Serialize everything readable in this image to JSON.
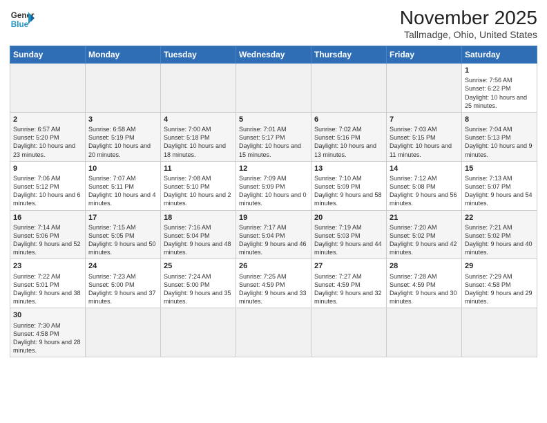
{
  "header": {
    "logo_line1": "General",
    "logo_line2": "Blue",
    "title": "November 2025",
    "subtitle": "Tallmadge, Ohio, United States"
  },
  "days_of_week": [
    "Sunday",
    "Monday",
    "Tuesday",
    "Wednesday",
    "Thursday",
    "Friday",
    "Saturday"
  ],
  "weeks": [
    [
      {
        "num": "",
        "info": ""
      },
      {
        "num": "",
        "info": ""
      },
      {
        "num": "",
        "info": ""
      },
      {
        "num": "",
        "info": ""
      },
      {
        "num": "",
        "info": ""
      },
      {
        "num": "",
        "info": ""
      },
      {
        "num": "1",
        "info": "Sunrise: 7:56 AM\nSunset: 6:22 PM\nDaylight: 10 hours\nand 25 minutes."
      }
    ],
    [
      {
        "num": "2",
        "info": "Sunrise: 6:57 AM\nSunset: 5:20 PM\nDaylight: 10 hours\nand 23 minutes."
      },
      {
        "num": "3",
        "info": "Sunrise: 6:58 AM\nSunset: 5:19 PM\nDaylight: 10 hours\nand 20 minutes."
      },
      {
        "num": "4",
        "info": "Sunrise: 7:00 AM\nSunset: 5:18 PM\nDaylight: 10 hours\nand 18 minutes."
      },
      {
        "num": "5",
        "info": "Sunrise: 7:01 AM\nSunset: 5:17 PM\nDaylight: 10 hours\nand 15 minutes."
      },
      {
        "num": "6",
        "info": "Sunrise: 7:02 AM\nSunset: 5:16 PM\nDaylight: 10 hours\nand 13 minutes."
      },
      {
        "num": "7",
        "info": "Sunrise: 7:03 AM\nSunset: 5:15 PM\nDaylight: 10 hours\nand 11 minutes."
      },
      {
        "num": "8",
        "info": "Sunrise: 7:04 AM\nSunset: 5:13 PM\nDaylight: 10 hours\nand 9 minutes."
      }
    ],
    [
      {
        "num": "9",
        "info": "Sunrise: 7:06 AM\nSunset: 5:12 PM\nDaylight: 10 hours\nand 6 minutes."
      },
      {
        "num": "10",
        "info": "Sunrise: 7:07 AM\nSunset: 5:11 PM\nDaylight: 10 hours\nand 4 minutes."
      },
      {
        "num": "11",
        "info": "Sunrise: 7:08 AM\nSunset: 5:10 PM\nDaylight: 10 hours\nand 2 minutes."
      },
      {
        "num": "12",
        "info": "Sunrise: 7:09 AM\nSunset: 5:09 PM\nDaylight: 10 hours\nand 0 minutes."
      },
      {
        "num": "13",
        "info": "Sunrise: 7:10 AM\nSunset: 5:09 PM\nDaylight: 9 hours\nand 58 minutes."
      },
      {
        "num": "14",
        "info": "Sunrise: 7:12 AM\nSunset: 5:08 PM\nDaylight: 9 hours\nand 56 minutes."
      },
      {
        "num": "15",
        "info": "Sunrise: 7:13 AM\nSunset: 5:07 PM\nDaylight: 9 hours\nand 54 minutes."
      }
    ],
    [
      {
        "num": "16",
        "info": "Sunrise: 7:14 AM\nSunset: 5:06 PM\nDaylight: 9 hours\nand 52 minutes."
      },
      {
        "num": "17",
        "info": "Sunrise: 7:15 AM\nSunset: 5:05 PM\nDaylight: 9 hours\nand 50 minutes."
      },
      {
        "num": "18",
        "info": "Sunrise: 7:16 AM\nSunset: 5:04 PM\nDaylight: 9 hours\nand 48 minutes."
      },
      {
        "num": "19",
        "info": "Sunrise: 7:17 AM\nSunset: 5:04 PM\nDaylight: 9 hours\nand 46 minutes."
      },
      {
        "num": "20",
        "info": "Sunrise: 7:19 AM\nSunset: 5:03 PM\nDaylight: 9 hours\nand 44 minutes."
      },
      {
        "num": "21",
        "info": "Sunrise: 7:20 AM\nSunset: 5:02 PM\nDaylight: 9 hours\nand 42 minutes."
      },
      {
        "num": "22",
        "info": "Sunrise: 7:21 AM\nSunset: 5:02 PM\nDaylight: 9 hours\nand 40 minutes."
      }
    ],
    [
      {
        "num": "23",
        "info": "Sunrise: 7:22 AM\nSunset: 5:01 PM\nDaylight: 9 hours\nand 38 minutes."
      },
      {
        "num": "24",
        "info": "Sunrise: 7:23 AM\nSunset: 5:00 PM\nDaylight: 9 hours\nand 37 minutes."
      },
      {
        "num": "25",
        "info": "Sunrise: 7:24 AM\nSunset: 5:00 PM\nDaylight: 9 hours\nand 35 minutes."
      },
      {
        "num": "26",
        "info": "Sunrise: 7:25 AM\nSunset: 4:59 PM\nDaylight: 9 hours\nand 33 minutes."
      },
      {
        "num": "27",
        "info": "Sunrise: 7:27 AM\nSunset: 4:59 PM\nDaylight: 9 hours\nand 32 minutes."
      },
      {
        "num": "28",
        "info": "Sunrise: 7:28 AM\nSunset: 4:59 PM\nDaylight: 9 hours\nand 30 minutes."
      },
      {
        "num": "29",
        "info": "Sunrise: 7:29 AM\nSunset: 4:58 PM\nDaylight: 9 hours\nand 29 minutes."
      }
    ],
    [
      {
        "num": "30",
        "info": "Sunrise: 7:30 AM\nSunset: 4:58 PM\nDaylight: 9 hours\nand 28 minutes."
      },
      {
        "num": "",
        "info": ""
      },
      {
        "num": "",
        "info": ""
      },
      {
        "num": "",
        "info": ""
      },
      {
        "num": "",
        "info": ""
      },
      {
        "num": "",
        "info": ""
      },
      {
        "num": "",
        "info": ""
      }
    ]
  ]
}
